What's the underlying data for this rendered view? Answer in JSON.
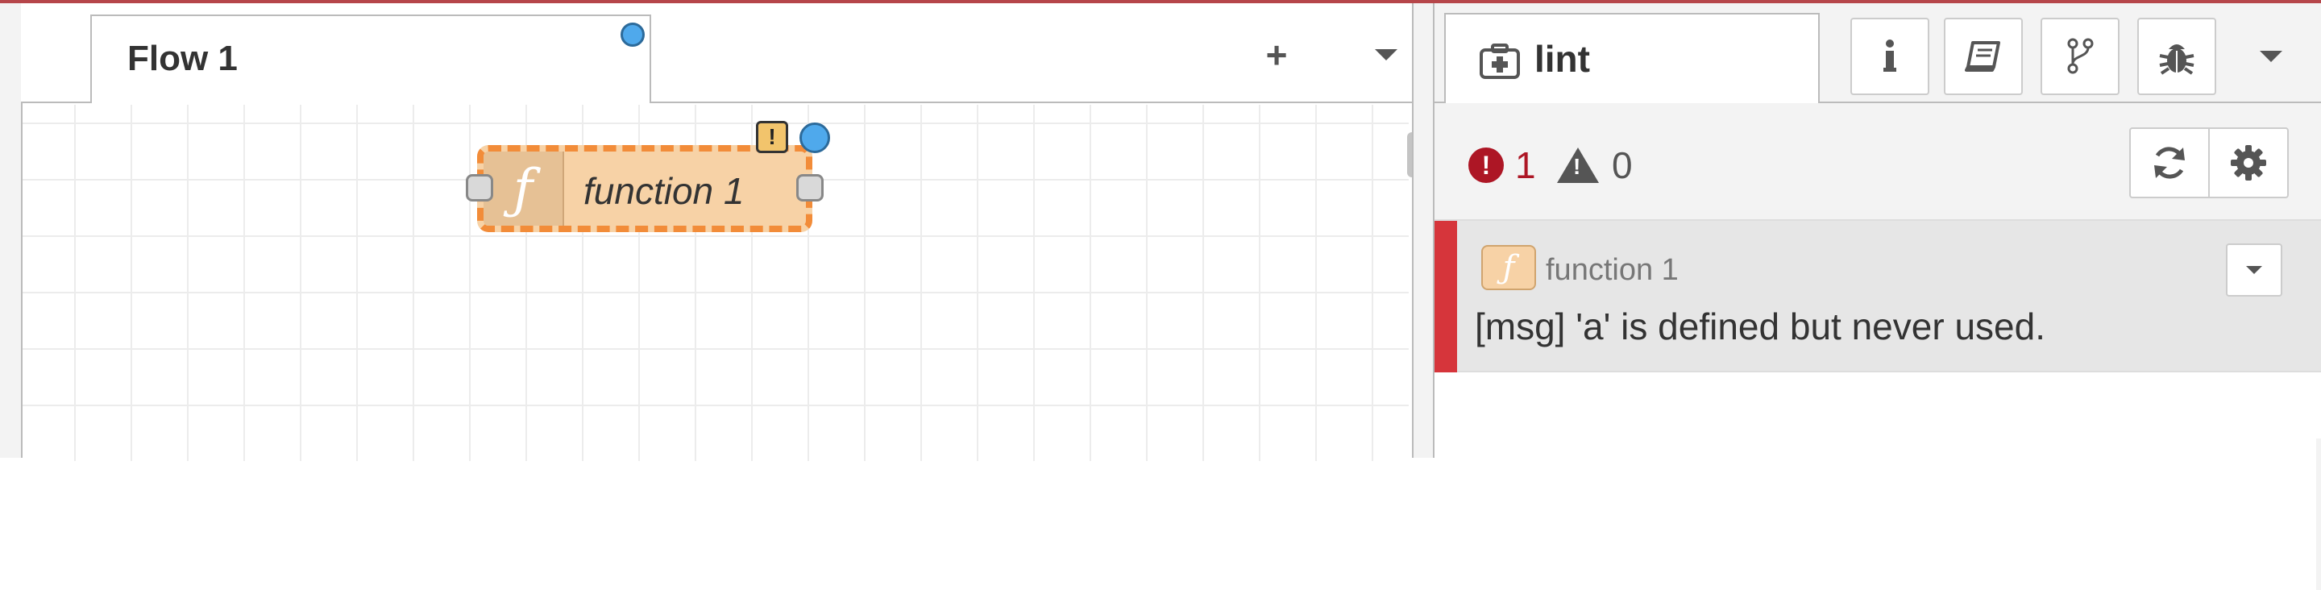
{
  "workspace": {
    "tab": {
      "label": "Flow 1"
    },
    "add_symbol": "+",
    "node": {
      "label": "function 1",
      "icon_glyph": "ƒ",
      "warn_glyph": "!"
    }
  },
  "sidebar": {
    "tab": {
      "label": "lint",
      "icon": "first-aid-kit-icon"
    },
    "buttons": [
      "info-icon",
      "book-icon",
      "git-branch-icon",
      "bug-icon"
    ],
    "counts": {
      "errors": "1",
      "warnings": "0",
      "error_glyph": "!",
      "warn_glyph": "!"
    },
    "issue": {
      "node_name": "function 1",
      "node_icon_glyph": "ƒ",
      "message": "[msg] 'a' is defined but never used."
    }
  },
  "colors": {
    "node_fill": "#f7d2a6",
    "node_border": "#f28c39",
    "error": "#ad1625",
    "error_stripe": "#d6353b",
    "changed_dot": "#4fa9ec"
  }
}
